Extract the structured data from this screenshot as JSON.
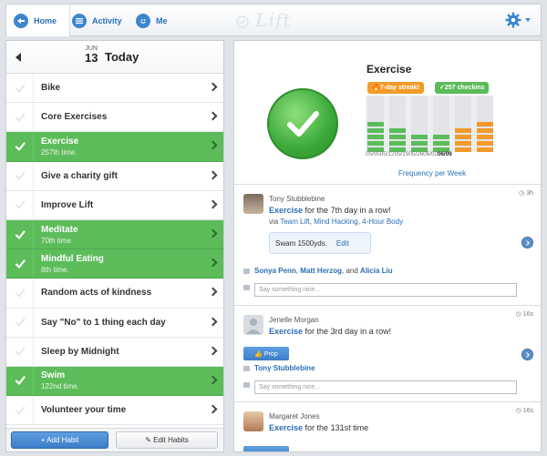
{
  "nav": {
    "home": "Home",
    "activity": "Activity",
    "me": "Me",
    "logo": "Lift",
    "icons": {
      "home": "home-icon",
      "activity": "activity-icon",
      "me": "me-icon",
      "settings": "gear-icon"
    }
  },
  "date": {
    "month": "JUN",
    "day": "13",
    "label": "Today"
  },
  "habits": [
    {
      "name": "Bike",
      "sub": "",
      "done": false
    },
    {
      "name": "Core Exercises",
      "sub": "",
      "done": false
    },
    {
      "name": "Exercise",
      "sub": "257th time.",
      "done": true
    },
    {
      "name": "Give a charity gift",
      "sub": "",
      "done": false
    },
    {
      "name": "Improve Lift",
      "sub": "",
      "done": false
    },
    {
      "name": "Meditate",
      "sub": "70th time.",
      "done": true
    },
    {
      "name": "Mindful Eating",
      "sub": "8th time.",
      "done": true
    },
    {
      "name": "Random acts of kindness",
      "sub": "",
      "done": false
    },
    {
      "name": "Say \"No\" to 1 thing each day",
      "sub": "",
      "done": false
    },
    {
      "name": "Sleep by Midnight",
      "sub": "",
      "done": false
    },
    {
      "name": "Swim",
      "sub": "122nd time.",
      "done": true
    },
    {
      "name": "Volunteer your time",
      "sub": "",
      "done": false
    }
  ],
  "footer": {
    "add": "+ Add Habit",
    "edit": "✎ Edit Habits"
  },
  "hero": {
    "title": "Exercise",
    "streak": "🔥7-day streak!",
    "checkins": "✓257 checkins",
    "dates": [
      "05/05",
      "05/12",
      "05/19",
      "05/26",
      "06/02",
      "06/09"
    ],
    "freq_label": "Frequency per Week",
    "weekly_counts": [
      5,
      4,
      3,
      3,
      4,
      5
    ],
    "colors": {
      "green": "#5cbc5a",
      "orange": "#f39a2a"
    }
  },
  "feed": [
    {
      "name": "Tony Stubblebine",
      "habit": "Exercise",
      "message": " for the 7th day in a row!",
      "via_prefix": "via ",
      "via_links": [
        "Team Lift",
        "Mind Hacking",
        "4-Hour Body"
      ],
      "time": "3h",
      "note": "Swam 1500yds.",
      "note_edit": "Edit",
      "props_names": [
        "Sonya Penn",
        "Matt Herzog"
      ],
      "props_and": ", and ",
      "props_last": "Alicia Liu",
      "comment_placeholder": "Say something nice..."
    },
    {
      "name": "Jenelle Morgan",
      "habit": "Exercise",
      "message": " for the 3rd day in a row!",
      "time": "16s",
      "prop_button": "👍 Prop",
      "props_last": "Tony Stubblebine",
      "comment_placeholder": "Say something nice..."
    },
    {
      "name": "Margaret Jones",
      "habit": "Exercise",
      "message": " for the 131st time",
      "time": "16s"
    }
  ]
}
